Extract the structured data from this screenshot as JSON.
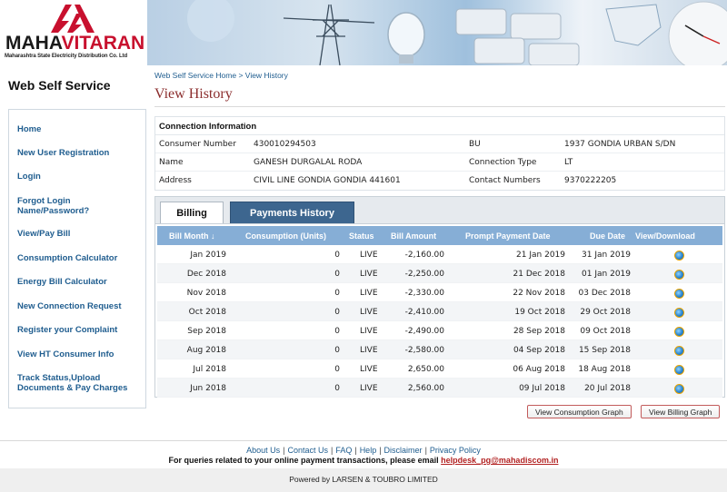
{
  "brand": {
    "logo_main": "MAHA",
    "logo_accent": "VITARAN",
    "logo_sub": "Maharashtra State Electricity Distribution Co. Ltd",
    "logo_color": "#c8102e"
  },
  "app_title": "Web Self Service",
  "breadcrumb": {
    "home": "Web Self Service Home",
    "sep": ">",
    "current": "View History"
  },
  "page_title": "View History",
  "sidebar": {
    "items": [
      {
        "label": "Home"
      },
      {
        "label": "New User Registration"
      },
      {
        "label": "Login"
      },
      {
        "label": "Forgot Login Name/Password?"
      },
      {
        "label": "View/Pay Bill"
      },
      {
        "label": "Consumption Calculator"
      },
      {
        "label": "Energy Bill Calculator"
      },
      {
        "label": "New Connection Request"
      },
      {
        "label": "Register your Complaint"
      },
      {
        "label": "View HT Consumer Info"
      },
      {
        "label": "Track Status,Upload Documents & Pay Charges"
      }
    ]
  },
  "connection": {
    "heading": "Connection Information",
    "consumer_number_label": "Consumer Number",
    "consumer_number": "430010294503",
    "bu_label": "BU",
    "bu": "1937 GONDIA URBAN S/DN",
    "name_label": "Name",
    "name": "GANESH DURGALAL RODA",
    "connection_type_label": "Connection Type",
    "connection_type": "LT",
    "address_label": "Address",
    "address": "CIVIL LINE GONDIA GONDIA 441601",
    "contact_label": "Contact Numbers",
    "contact": "9370222205"
  },
  "tabs": {
    "billing": "Billing",
    "payments": "Payments History"
  },
  "billing": {
    "columns": {
      "month": "Bill Month ↓",
      "consumption": "Consumption (Units)",
      "status": "Status",
      "amount": "Bill Amount",
      "prompt": "Prompt Payment Date",
      "due": "Due Date",
      "view": "View/Download"
    },
    "rows": [
      {
        "month": "Jan 2019",
        "consumption": "0",
        "status": "LIVE",
        "amount": "-2,160.00",
        "prompt": "21 Jan 2019",
        "due": "31 Jan 2019"
      },
      {
        "month": "Dec 2018",
        "consumption": "0",
        "status": "LIVE",
        "amount": "-2,250.00",
        "prompt": "21 Dec 2018",
        "due": "01 Jan 2019"
      },
      {
        "month": "Nov 2018",
        "consumption": "0",
        "status": "LIVE",
        "amount": "-2,330.00",
        "prompt": "22 Nov 2018",
        "due": "03 Dec 2018"
      },
      {
        "month": "Oct 2018",
        "consumption": "0",
        "status": "LIVE",
        "amount": "-2,410.00",
        "prompt": "19 Oct 2018",
        "due": "29 Oct 2018"
      },
      {
        "month": "Sep 2018",
        "consumption": "0",
        "status": "LIVE",
        "amount": "-2,490.00",
        "prompt": "28 Sep 2018",
        "due": "09 Oct 2018"
      },
      {
        "month": "Aug 2018",
        "consumption": "0",
        "status": "LIVE",
        "amount": "-2,580.00",
        "prompt": "04 Sep 2018",
        "due": "15 Sep 2018"
      },
      {
        "month": "Jul 2018",
        "consumption": "0",
        "status": "LIVE",
        "amount": "2,650.00",
        "prompt": "06 Aug 2018",
        "due": "18 Aug 2018"
      },
      {
        "month": "Jun 2018",
        "consumption": "0",
        "status": "LIVE",
        "amount": "2,560.00",
        "prompt": "09 Jul 2018",
        "due": "20 Jul 2018"
      }
    ]
  },
  "buttons": {
    "consumption_graph": "View Consumption Graph",
    "billing_graph": "View Billing Graph"
  },
  "footer": {
    "links": [
      "About Us",
      "Contact Us",
      "FAQ",
      "Help",
      "Disclaimer",
      "Privacy Policy"
    ],
    "query_text": "For queries related to your online payment transactions, please email",
    "email": "helpdesk_pg@mahadiscom.in",
    "powered": "Powered by LARSEN & TOUBRO LIMITED"
  }
}
